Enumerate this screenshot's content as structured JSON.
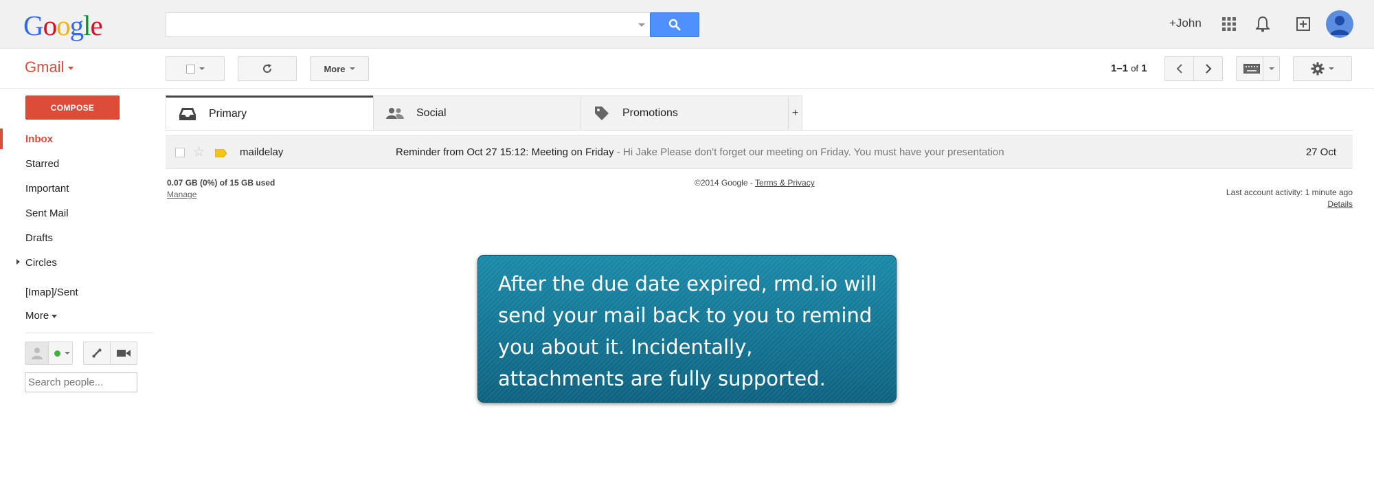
{
  "header": {
    "logo": "Google",
    "logo_colors": [
      "#3369e8",
      "#d50f25",
      "#eeb211",
      "#3369e8",
      "#009925",
      "#d50f25"
    ],
    "search_placeholder": "",
    "user_name": "+John",
    "icons": [
      "apps-grid-icon",
      "bell-icon",
      "share-plus-icon",
      "avatar-icon"
    ]
  },
  "toolbar": {
    "app_label": "Gmail",
    "more_label": "More",
    "pager_range": "1–1",
    "pager_of": "of",
    "pager_total": "1"
  },
  "nav": {
    "compose": "COMPOSE",
    "items": [
      "Inbox",
      "Starred",
      "Important",
      "Sent Mail",
      "Drafts",
      "Circles",
      "[Imap]/Sent"
    ],
    "more": "More",
    "search_people_placeholder": "Search people..."
  },
  "tabs": [
    {
      "label": "Primary"
    },
    {
      "label": "Social"
    },
    {
      "label": "Promotions"
    }
  ],
  "tab_add": "+",
  "mail": {
    "sender": "maildelay",
    "subject": "Reminder from Oct 27 15:12: Meeting on Friday",
    "snippet": " - Hi Jake Please don't forget our meeting on Friday. You must have your presentation",
    "date": "27 Oct"
  },
  "footer": {
    "storage": "0.07 GB (0%) of 15 GB used",
    "manage": "Manage",
    "copyright": "©2014 Google - ",
    "terms": "Terms & Privacy",
    "activity": "Last account activity: 1 minute ago",
    "details": "Details"
  },
  "callout": {
    "text": "After the due date expired, rmd.io will send your mail back to you to remind you about it. Incidentally, attachments are fully supported."
  },
  "colors": {
    "accent_red": "#dd4b39",
    "search_blue": "#4d90fe",
    "callout_teal": "#1a8aa8"
  }
}
